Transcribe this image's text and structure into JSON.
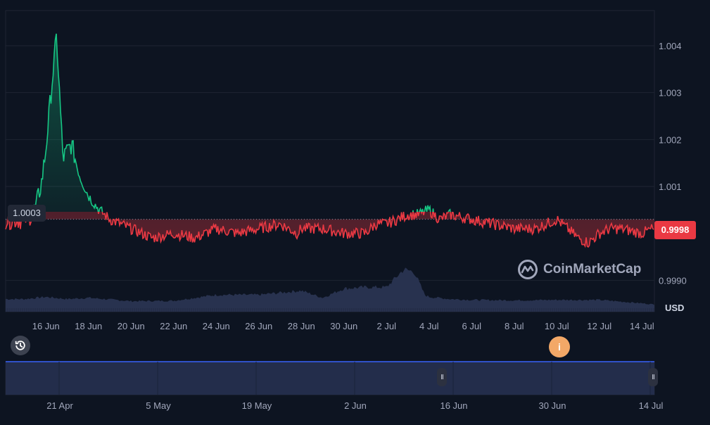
{
  "chart_data": {
    "type": "line",
    "y_axis": {
      "ticks": [
        "1.004",
        "1.003",
        "1.002",
        "1.001",
        "0.9990"
      ],
      "tick_values": [
        1.004,
        1.003,
        1.002,
        1.001,
        0.999
      ],
      "ylim": [
        0.99833,
        1.00475
      ],
      "unit": "USD"
    },
    "x_axis": {
      "ticks": [
        "16 Jun",
        "18 Jun",
        "20 Jun",
        "22 Jun",
        "24 Jun",
        "26 Jun",
        "28 Jun",
        "30 Jun",
        "2 Jul",
        "4 Jul",
        "6 Jul",
        "8 Jul",
        "10 Jul",
        "12 Jul",
        "14 Jul"
      ],
      "range": [
        "15 Jun",
        "15 Jul"
      ]
    },
    "baseline": {
      "label": "1.0003",
      "value": 1.0003
    },
    "current_price": {
      "label": "0.9998",
      "value": 0.9998
    },
    "series": [
      {
        "color_up": "#16c784",
        "color_down": "#ea3943",
        "keypoints_x": [
          "15 Jun",
          "15.3 Jun",
          "15.5 Jun",
          "15.8 Jun",
          "16 Jun",
          "16.2 Jun",
          "16.5 Jun",
          "16.8 Jun",
          "17.2 Jun",
          "17.6 Jun",
          "18 Jun",
          "18.5 Jun",
          "19 Jun",
          "19.5 Jun",
          "20 Jun",
          "20.5 Jun",
          "21 Jun",
          "22 Jun",
          "23 Jun",
          "24 Jun",
          "25 Jun",
          "26 Jun",
          "27 Jun",
          "27.8 Jun",
          "28 Jun",
          "29 Jun",
          "30 Jun",
          "1 Jul",
          "1.5 Jul",
          "2 Jul",
          "2.5 Jul",
          "3 Jul",
          "3.5 Jul",
          "4 Jul",
          "4.5 Jul",
          "5 Jul",
          "6 Jul",
          "7 Jul",
          "8 Jul",
          "9 Jul",
          "9.5 Jul",
          "10 Jul",
          "10.5 Jul",
          "11 Jul",
          "11.5 Jul",
          "12 Jul",
          "12.5 Jul",
          "13 Jul",
          "14 Jul",
          "14.5 Jul",
          "15 Jul"
        ],
        "keypoints_y": [
          1.0003,
          1.0004,
          1.0005,
          1.0011,
          1.0018,
          1.0028,
          1.0042,
          1.0016,
          1.0019,
          1.0012,
          1.0008,
          1.0005,
          1.0003,
          1.0002,
          1.0001,
          1.0,
          0.9999,
          1.0,
          0.9999,
          1.0001,
          1.0,
          1.0001,
          1.0002,
          1.0,
          1.0001,
          1.0001,
          1.0,
          1.0,
          1.0002,
          1.0002,
          1.0003,
          1.0004,
          1.0004,
          1.0005,
          1.0003,
          1.0004,
          1.0003,
          1.0002,
          1.0001,
          1.0001,
          1.0002,
          1.0003,
          1.0001,
          0.9999,
          0.9998,
          1.0,
          1.0001,
          1.0001,
          1.0,
          1.0001,
          0.9998
        ]
      }
    ],
    "volume": {
      "keypoints_x": [
        "15 Jun",
        "16 Jun",
        "17 Jun",
        "18 Jun",
        "20 Jun",
        "22 Jun",
        "24 Jun",
        "26 Jun",
        "27 Jun",
        "28 Jun",
        "29 Jun",
        "30 Jun",
        "1 Jul",
        "2 Jul",
        "2.8 Jul",
        "3.3 Jul",
        "3.8 Jul",
        "4 Jul",
        "5 Jul",
        "6 Jul",
        "8 Jul",
        "10 Jul",
        "12 Jul",
        "14 Jul",
        "15 Jul"
      ],
      "keypoints_rel": [
        0.3,
        0.35,
        0.3,
        0.33,
        0.25,
        0.26,
        0.4,
        0.4,
        0.45,
        0.5,
        0.33,
        0.55,
        0.58,
        0.58,
        1.0,
        0.95,
        0.4,
        0.35,
        0.3,
        0.28,
        0.27,
        0.28,
        0.28,
        0.2,
        0.15
      ]
    }
  },
  "navigator": {
    "ticks": [
      "21 Apr",
      "5 May",
      "19 May",
      "2 Jun",
      "16 Jun",
      "30 Jun",
      "14 Jul"
    ],
    "handle_left_glyph": "II",
    "handle_right_glyph": "II"
  },
  "ui": {
    "currency_label": "USD",
    "brand_name": "CoinMarketCap",
    "info_glyph": "i",
    "history_icon": "history-icon",
    "colors": {
      "background": "#0d1421",
      "up": "#16c784",
      "down": "#ea3943",
      "volume": "#28324f",
      "navigator": "#24304f",
      "info": "#f3a867"
    }
  }
}
